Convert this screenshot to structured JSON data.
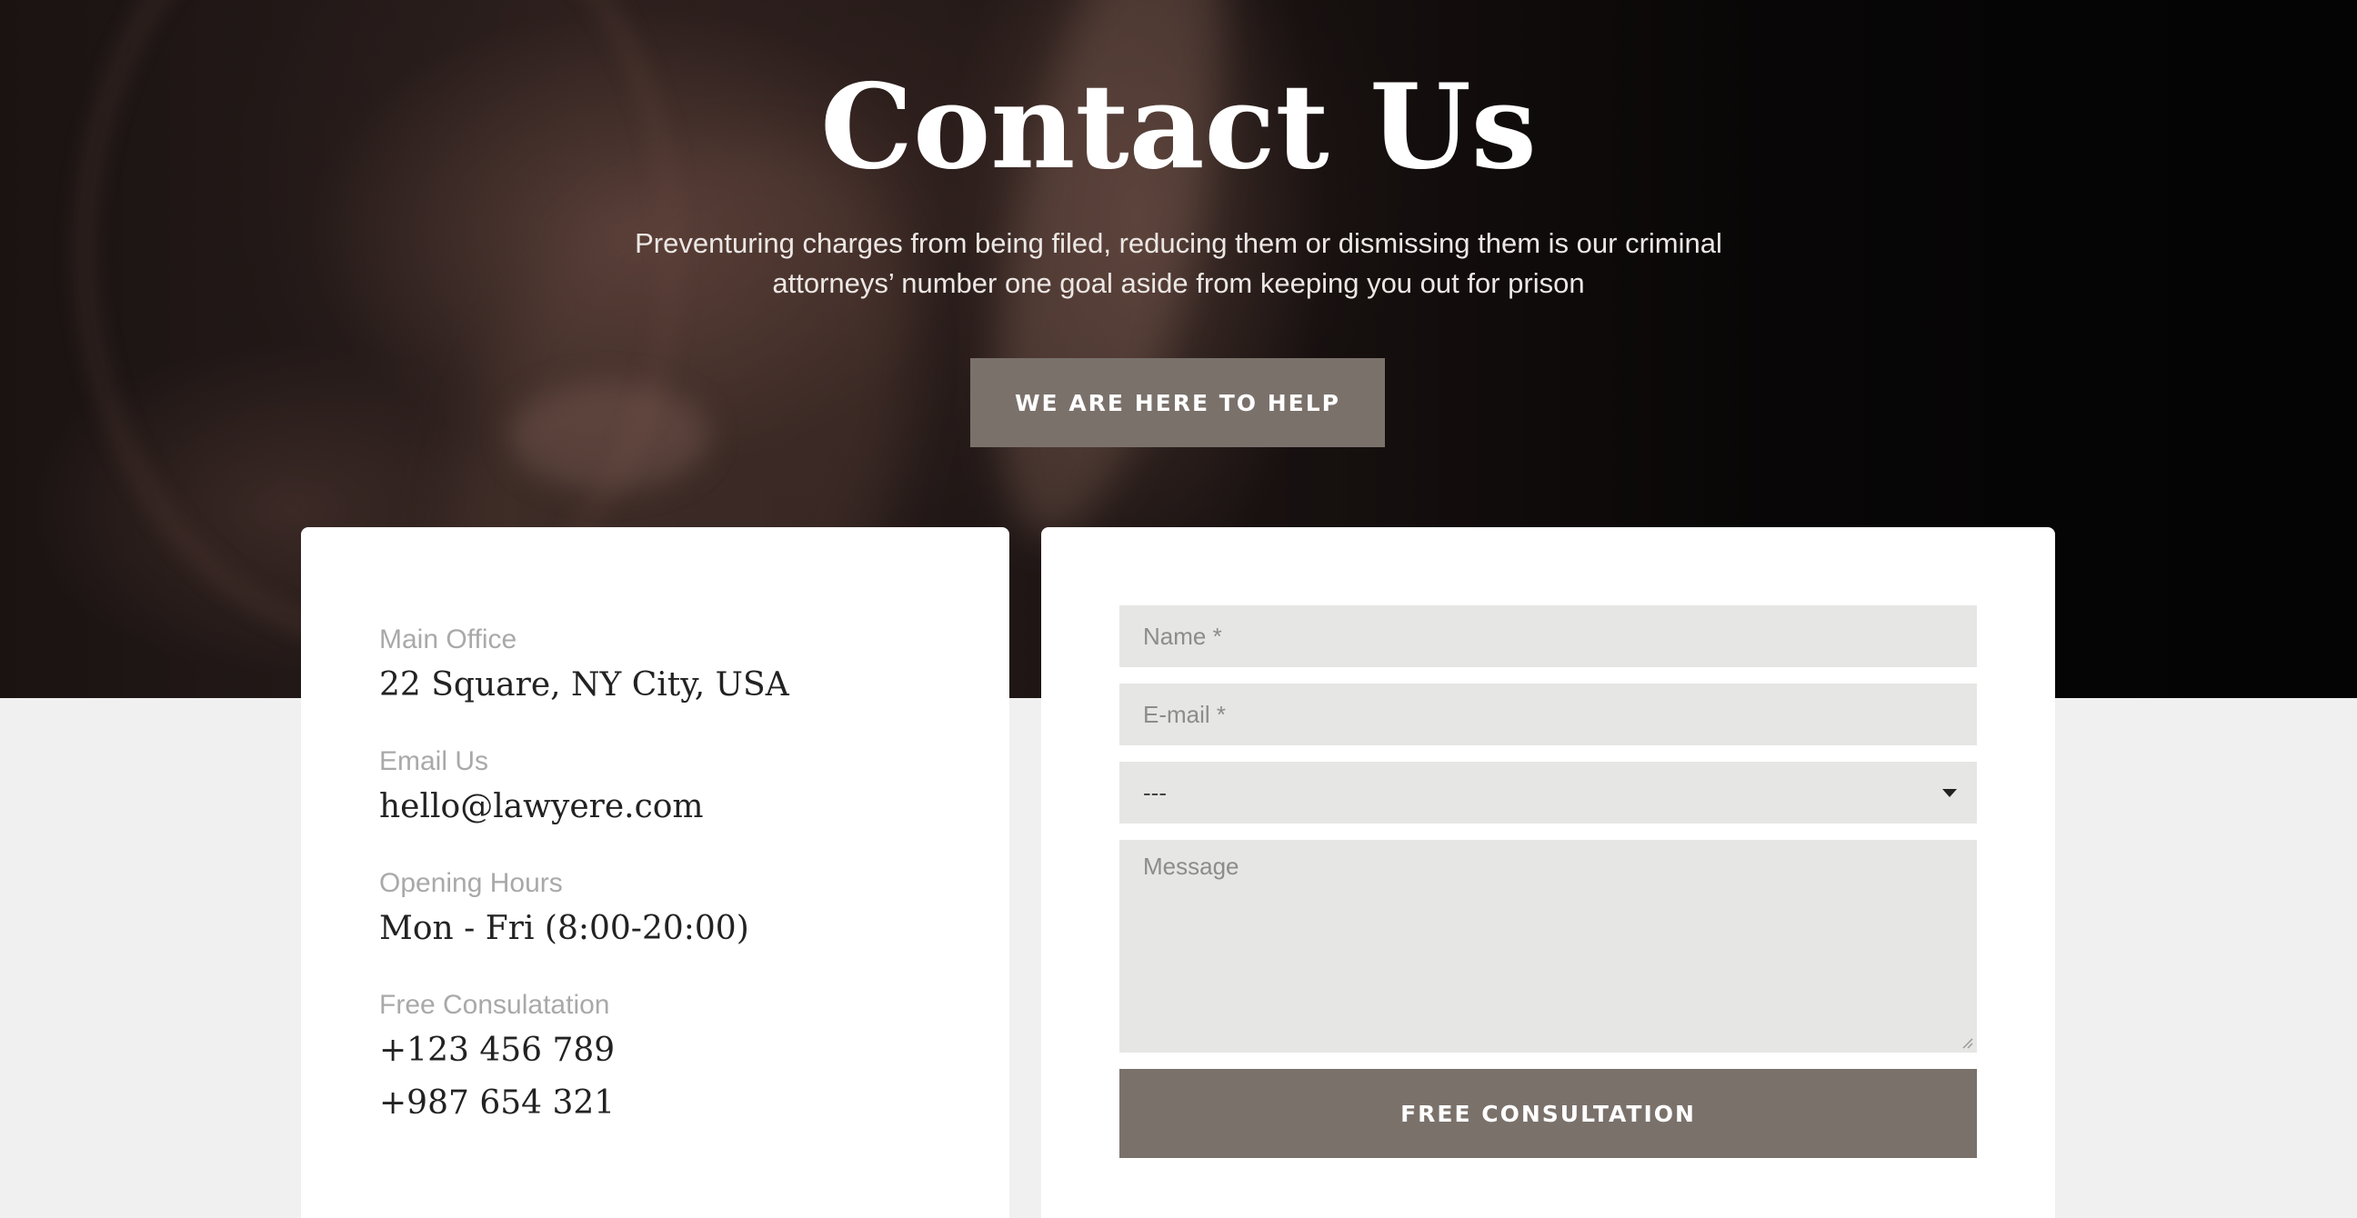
{
  "hero": {
    "title": "Contact Us",
    "subtitle": "Preventuring charges from being filed, reducing them or dismissing them is our criminal attorneys’ number one goal aside from keeping you out for prison",
    "button_label": "WE ARE HERE TO HELP"
  },
  "contact_info": [
    {
      "label": "Main Office",
      "value": "22 Square, NY City, USA"
    },
    {
      "label": "Email Us",
      "value": "hello@lawyere.com"
    },
    {
      "label": "Opening Hours",
      "value": "Mon - Fri (8:00-20:00)"
    },
    {
      "label": "Free Consulatation",
      "values": [
        "+123 456 789",
        "+987 654 321"
      ]
    }
  ],
  "form": {
    "name_placeholder": "Name *",
    "email_placeholder": "E-mail *",
    "select_value": "---",
    "message_placeholder": "Message",
    "submit_label": "FREE CONSULTATION"
  },
  "colors": {
    "accent": "#7a716b",
    "field_bg": "#e6e6e4",
    "page_bg": "#f0f0f0"
  }
}
